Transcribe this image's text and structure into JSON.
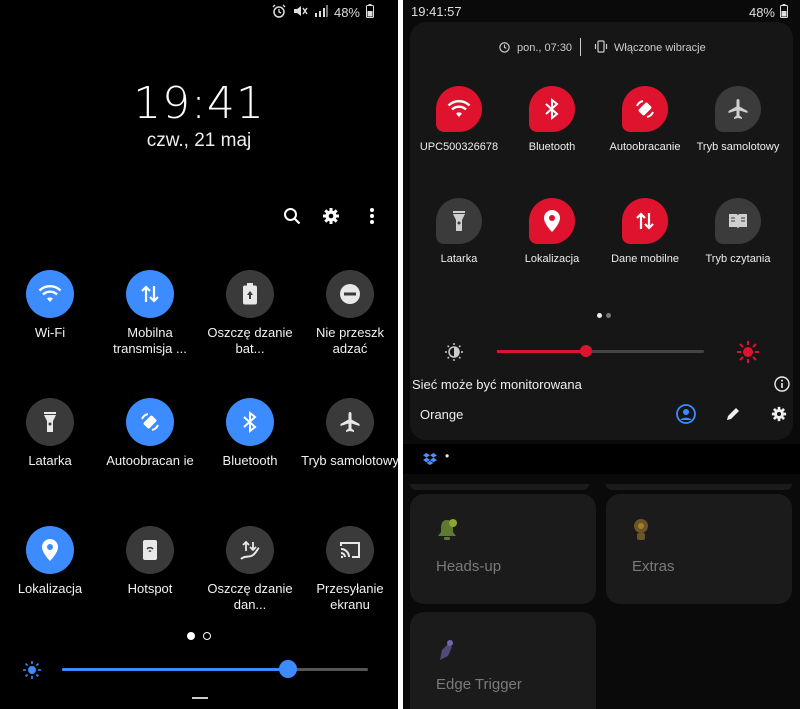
{
  "left": {
    "status": {
      "battery": "48%"
    },
    "clock": "19:41",
    "date": "czw., 21 maj",
    "tiles": [
      {
        "label": "Wi-Fi",
        "icon": "wifi-icon",
        "active": true
      },
      {
        "label": "Mobilna transmisja ...",
        "icon": "mobile-data-icon",
        "active": true
      },
      {
        "label": "Oszczę dzanie bat...",
        "icon": "battery-saver-icon",
        "active": false
      },
      {
        "label": "Nie przeszk adzać",
        "icon": "do-not-disturb-icon",
        "active": false
      },
      {
        "label": "Latarka",
        "icon": "flashlight-icon",
        "active": false
      },
      {
        "label": "Autoobracan ie",
        "icon": "auto-rotate-icon",
        "active": true
      },
      {
        "label": "Bluetooth",
        "icon": "bluetooth-icon",
        "active": true
      },
      {
        "label": "Tryb samolotowy",
        "icon": "airplane-icon",
        "active": false
      },
      {
        "label": "Lokalizacja",
        "icon": "location-icon",
        "active": true
      },
      {
        "label": "Hotspot",
        "icon": "hotspot-icon",
        "active": false
      },
      {
        "label": "Oszczę dzanie dan...",
        "icon": "data-saver-icon",
        "active": false
      },
      {
        "label": "Przesyłanie ekranu",
        "icon": "screen-cast-icon",
        "active": false
      }
    ],
    "page_indicator": {
      "current": 1,
      "total": 2
    },
    "brightness": 0.74,
    "accent": "#3d8cff"
  },
  "right": {
    "status": {
      "time": "19:41:57",
      "battery": "48%"
    },
    "alarm": "pon., 07:30",
    "sound_mode": "Włączone wibracje",
    "tiles": [
      {
        "label": "UPC500326678",
        "icon": "wifi-icon",
        "active": true
      },
      {
        "label": "Bluetooth",
        "icon": "bluetooth-icon",
        "active": true
      },
      {
        "label": "Autoobracanie",
        "icon": "auto-rotate-icon",
        "active": true
      },
      {
        "label": "Tryb samolotowy",
        "icon": "airplane-icon",
        "active": false
      },
      {
        "label": "Latarka",
        "icon": "flashlight-icon",
        "active": false
      },
      {
        "label": "Lokalizacja",
        "icon": "location-icon",
        "active": true
      },
      {
        "label": "Dane mobilne",
        "icon": "mobile-data-icon",
        "active": true
      },
      {
        "label": "Tryb czytania",
        "icon": "reading-mode-icon",
        "active": false
      }
    ],
    "page_indicator": {
      "current": 1,
      "total": 2
    },
    "brightness": 0.43,
    "network_monitored": "Sieć może być monitorowana",
    "carrier": "Orange",
    "notification": "•",
    "plugins": [
      {
        "label": "Heads-up",
        "icon": "heads-up-icon"
      },
      {
        "label": "Extras",
        "icon": "extras-icon"
      },
      {
        "label": "Edge Trigger",
        "icon": "edge-trigger-icon"
      }
    ],
    "accent": "#e0132e"
  }
}
